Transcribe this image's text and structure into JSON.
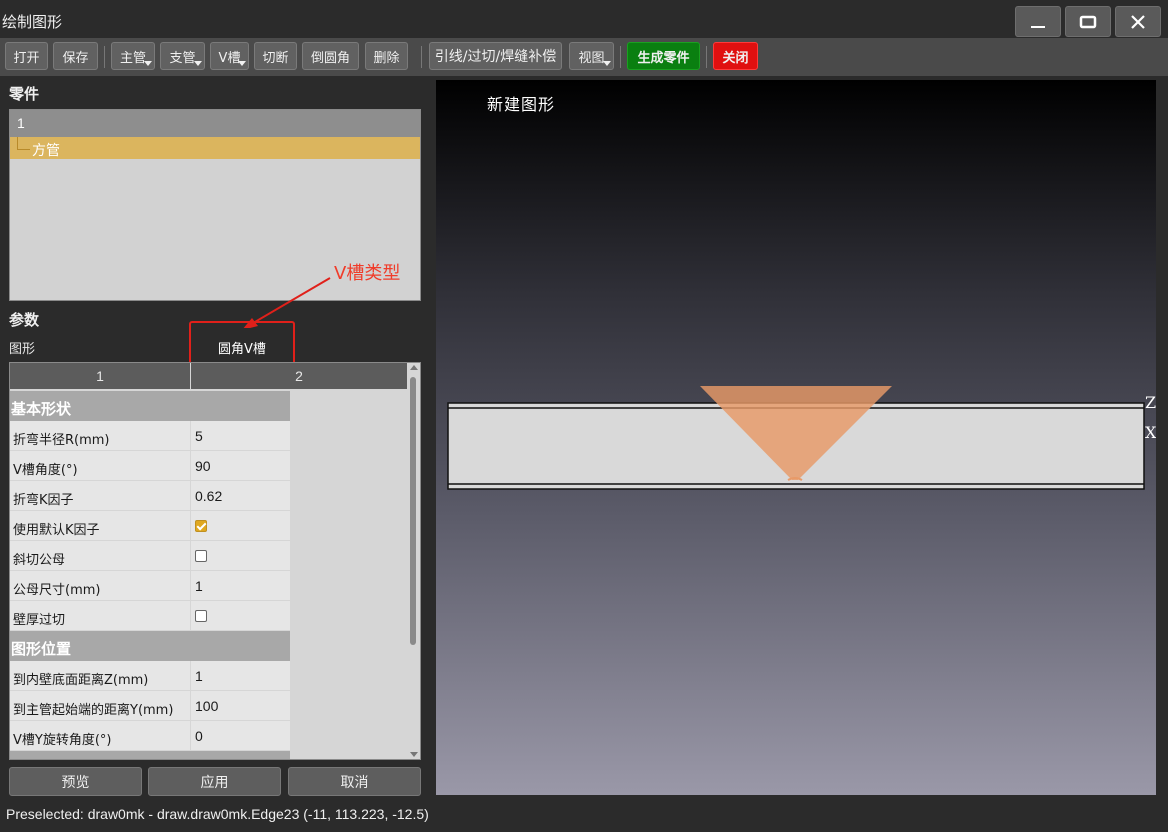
{
  "window": {
    "title": "绘制图形",
    "buttons": [
      "minimize-icon",
      "maximize-icon",
      "close-icon"
    ]
  },
  "toolbar": {
    "open": "打开",
    "save": "保存",
    "main_pipe": "主管",
    "branch_pipe": "支管",
    "v_groove": "V槽",
    "cut": "切断",
    "fillet": "倒圆角",
    "delete": "删除",
    "lead_line": "引线/过切/焊缝补偿",
    "view": "视图",
    "generate_part": "生成零件",
    "close": "关闭"
  },
  "parts": {
    "heading": "零件",
    "column_header": "1",
    "items": [
      {
        "label": "方管",
        "selected": true
      }
    ]
  },
  "params": {
    "heading": "参数",
    "shape_label": "图形",
    "shape_value": "圆角V槽",
    "annotation": "V槽类型",
    "columns": [
      "1",
      "2"
    ],
    "sections": [
      {
        "title": "基本形状",
        "rows": [
          {
            "name": "折弯半径R(mm)",
            "value": "5"
          },
          {
            "name": "V槽角度(°)",
            "value": "90"
          },
          {
            "name": "折弯K因子",
            "value": "0.62"
          },
          {
            "name": "使用默认K因子",
            "checked": true
          },
          {
            "name": "斜切公母",
            "checked": false
          },
          {
            "name": "公母尺寸(mm)",
            "value": "1"
          },
          {
            "name": "壁厚过切",
            "checked": false
          }
        ]
      },
      {
        "title": "图形位置",
        "rows": [
          {
            "name": "到内壁底面距离Z(mm)",
            "value": "1"
          },
          {
            "name": "到主管起始端的距离Y(mm)",
            "value": "100"
          },
          {
            "name": "V槽Y旋转角度(°)",
            "value": "0"
          }
        ]
      }
    ]
  },
  "actions": {
    "preview": "预览",
    "apply": "应用",
    "cancel": "取消"
  },
  "viewport": {
    "title": "新建图形",
    "axis_z": "Z",
    "axis_x": "X",
    "colors": {
      "pipe": "#d9d9d9",
      "groove": "#e89a68"
    }
  },
  "status": {
    "text": "Preselected: draw0mk - draw.draw0mk.Edge23 (-11, 113.223, -12.5)"
  }
}
